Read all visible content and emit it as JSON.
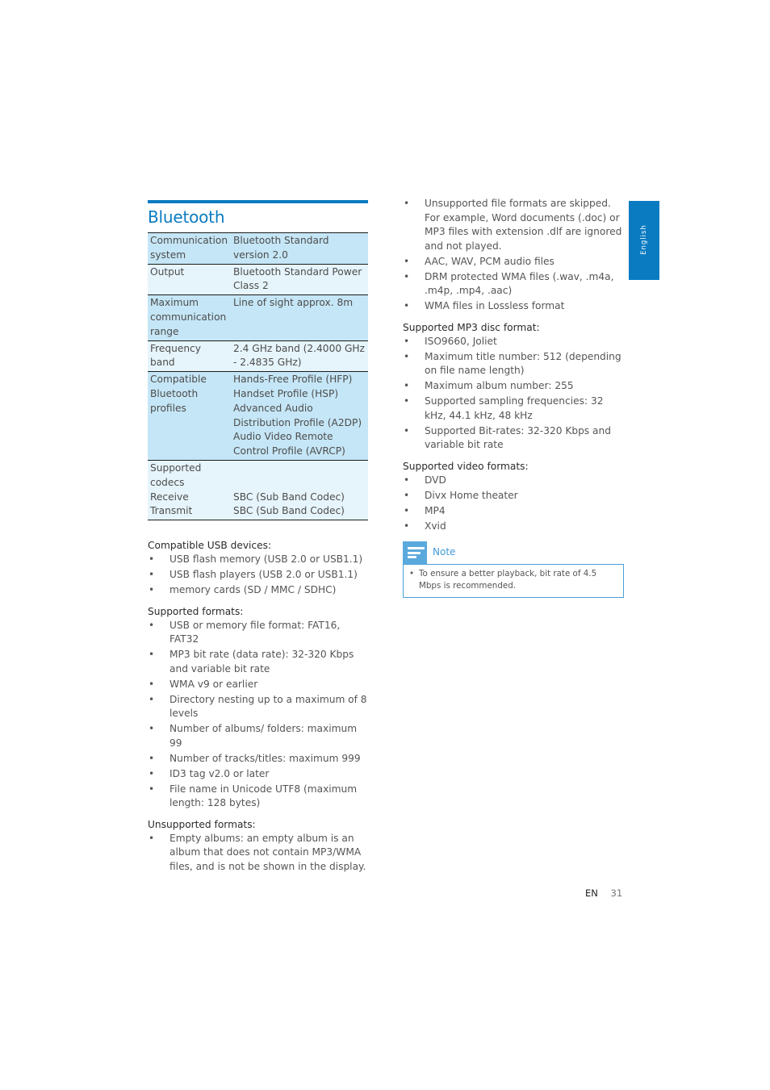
{
  "section": {
    "title": "Bluetooth"
  },
  "spec_table": [
    {
      "key": "Communication system",
      "value": "Bluetooth Standard version 2.0",
      "shade": "dark"
    },
    {
      "key": "Output",
      "value": "Bluetooth Standard Power Class 2",
      "shade": "light"
    },
    {
      "key": "Maximum communication range",
      "value": "Line of sight approx. 8m",
      "shade": "dark"
    },
    {
      "key": "Frequency band",
      "value": "2.4 GHz band (2.4000 GHz - 2.4835 GHz)",
      "shade": "light"
    },
    {
      "key": "Compatible Bluetooth profiles",
      "value_lines": [
        "Hands-Free Profile (HFP)",
        "Handset Profile (HSP)",
        "Advanced Audio Distribution Profile (A2DP)",
        "Audio Video Remote Control Profile (AVRCP)"
      ],
      "shade": "dark"
    },
    {
      "key": "Supported codecs",
      "sub_rows": [
        {
          "key": "Receive",
          "value": "SBC (Sub Band Codec)"
        },
        {
          "key": "Transmit",
          "value": "SBC (Sub Band Codec)"
        }
      ],
      "shade": "light"
    }
  ],
  "usb_devices": {
    "heading": "Compatible USB devices:",
    "items": [
      "USB flash memory (USB 2.0 or USB1.1)",
      "USB flash players (USB 2.0 or USB1.1)",
      "memory cards (SD / MMC / SDHC)"
    ]
  },
  "supported_formats": {
    "heading": "Supported formats:",
    "items": [
      "USB or memory file format: FAT16, FAT32",
      "MP3 bit rate (data rate): 32-320 Kbps and variable bit rate",
      "WMA v9 or earlier",
      "Directory nesting up to a maximum of 8 levels",
      "Number of albums/ folders: maximum 99",
      "Number of tracks/titles: maximum 999",
      "ID3 tag v2.0 or later",
      "File name in Unicode UTF8 (maximum length: 128 bytes)"
    ]
  },
  "unsupported_formats": {
    "heading": "Unsupported formats:",
    "items": [
      "Empty albums: an empty album is an album that does not contain MP3/WMA files, and is not be shown in the display.",
      "Unsupported file formats are skipped. For example, Word documents (.doc) or MP3 files with extension .dlf are ignored and not played.",
      "AAC, WAV, PCM audio files",
      "DRM protected WMA files (.wav, .m4a, .m4p, .mp4, .aac)",
      "WMA files in Lossless format"
    ]
  },
  "mp3_disc_format": {
    "heading": "Supported MP3 disc format:",
    "items": [
      "ISO9660, Joliet",
      "Maximum title number: 512 (depending on file name length)",
      "Maximum album number: 255",
      "Supported sampling frequencies: 32 kHz, 44.1 kHz, 48 kHz",
      "Supported Bit-rates: 32-320 Kbps and variable bit rate"
    ]
  },
  "video_formats": {
    "heading": "Supported video formats:",
    "items": [
      "DVD",
      "Divx Home theater",
      "MP4",
      "Xvid"
    ]
  },
  "note": {
    "icon": "note-icon",
    "label": "Note",
    "items": [
      "To ensure a better playback, bit rate of 4.5 Mbps is recommended."
    ]
  },
  "side_tab": {
    "label": "English",
    "color": "#0a7bc1"
  },
  "footer": {
    "lang": "EN",
    "page": "31"
  },
  "bullet": "•"
}
